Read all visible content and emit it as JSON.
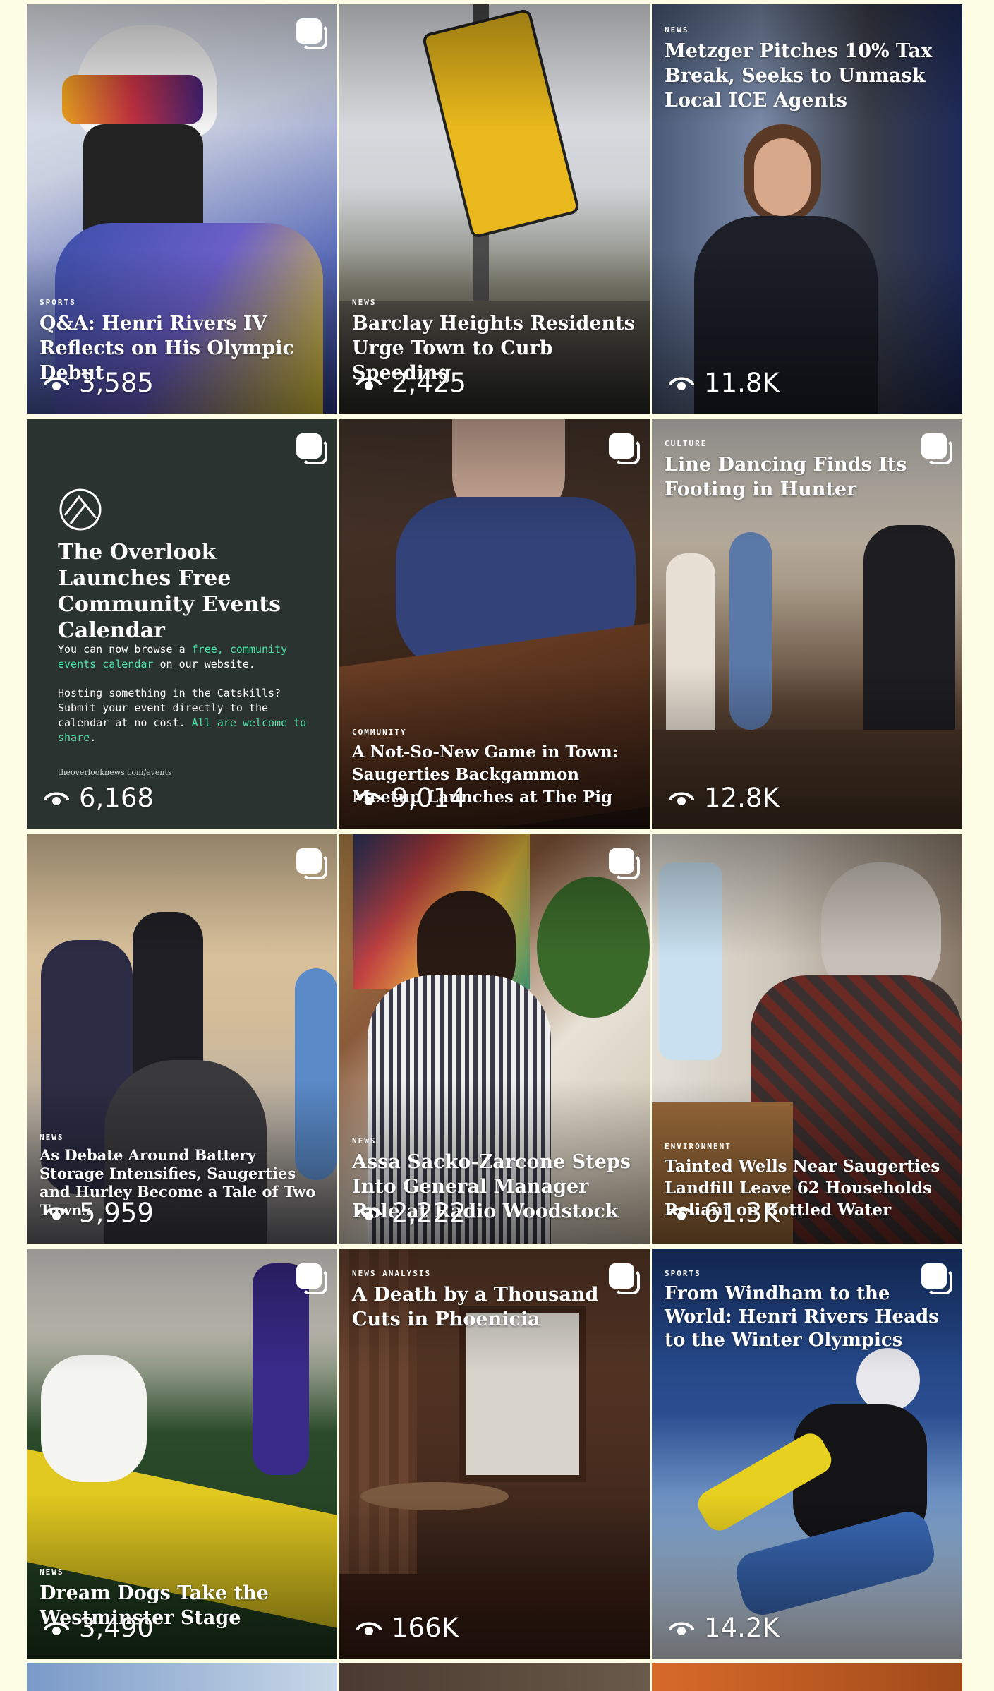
{
  "grid": {
    "tiles": [
      {
        "kicker": "SPORTS",
        "headline": "Q&A: Henri Rivers IV Reflects on His Olympic Debut",
        "views": "3,585",
        "multi": true,
        "colors": [
          "#e8ecf2",
          "#8a93b8",
          "#3b4fa8"
        ]
      },
      {
        "kicker": "NEWS",
        "headline": "Barclay Heights Residents Urge Town to Curb Speeding",
        "views": "2,425",
        "multi": false,
        "colors": [
          "#d7d9dc",
          "#9a9a8e",
          "#3d3d38"
        ]
      },
      {
        "kicker": "NEWS",
        "headline": "Metzger Pitches 10% Tax Break, Seeks to Unmask Local ICE Agents",
        "views": "11.8K",
        "multi": false,
        "colors": [
          "#6f7f99",
          "#2d3444",
          "#1a1d26"
        ]
      },
      {
        "type": "events",
        "title": "The Overlook Launches Free Community Events Calendar",
        "body_1_a": "You can now browse a ",
        "body_1_hl": "free, community events calendar",
        "body_1_b": " on our website.",
        "body_2_a": "Hosting something in the Catskills? Submit your event directly to the calendar at no cost. ",
        "body_2_hl": "All are welcome to share",
        "body_2_b": ".",
        "url": "theoverlooknews.com/events",
        "views": "6,168",
        "multi": true
      },
      {
        "kicker": "COMMUNITY",
        "headline": "A Not-So-New Game in Town: Saugerties Backgammon Meetup Launches at The Pig",
        "views": "9,014",
        "multi": true,
        "colors": [
          "#3a4a78",
          "#5a3a24",
          "#2a1a12"
        ]
      },
      {
        "kicker": "CULTURE",
        "headline": "Line Dancing Finds Its Footing in Hunter",
        "views": "12.8K",
        "multi": true,
        "top": true,
        "colors": [
          "#cfcdc6",
          "#6a5540",
          "#3a2c22"
        ]
      },
      {
        "kicker": "NEWS",
        "headline": "As Debate Around Battery Storage Intensifies, Saugerties and Hurley Become a Tale of Two Towns",
        "views": "5,959",
        "multi": true,
        "colors": [
          "#d8c2a0",
          "#6a7a9a",
          "#2a2a30"
        ]
      },
      {
        "kicker": "NEWS",
        "headline": "Assa Sacko-Zarcone Steps Into General Manager Role at Radio Woodstock",
        "views": "2,222",
        "multi": true,
        "colors": [
          "#b58a4a",
          "#2e3a6a",
          "#e8e2d8"
        ]
      },
      {
        "kicker": "ENVIRONMENT",
        "headline": "Tainted Wells Near Saugerties Landfill Leave 62 Households Reliant on Bottled Water",
        "views": "61.3K",
        "multi": false,
        "colors": [
          "#d8d2c8",
          "#7a4a3a",
          "#2a2220"
        ]
      },
      {
        "kicker": "NEWS",
        "headline": "Dream Dogs Take the Westminster Stage",
        "views": "3,490",
        "multi": true,
        "colors": [
          "#dcd8cc",
          "#2a4a2a",
          "#d8c020"
        ]
      },
      {
        "kicker": "NEWS ANALYSIS",
        "headline": "A Death by a Thousand Cuts in Phoenicia",
        "views": "166K",
        "multi": true,
        "top": true,
        "colors": [
          "#4a2e20",
          "#6a4430",
          "#2a1810"
        ]
      },
      {
        "kicker": "SPORTS",
        "headline": "From Windham to the World: Henri Rivers Heads to the Winter Olympics",
        "views": "14.2K",
        "multi": true,
        "top": true,
        "colors": [
          "#1f3f78",
          "#6a90c8",
          "#f0f4fa"
        ]
      }
    ]
  }
}
